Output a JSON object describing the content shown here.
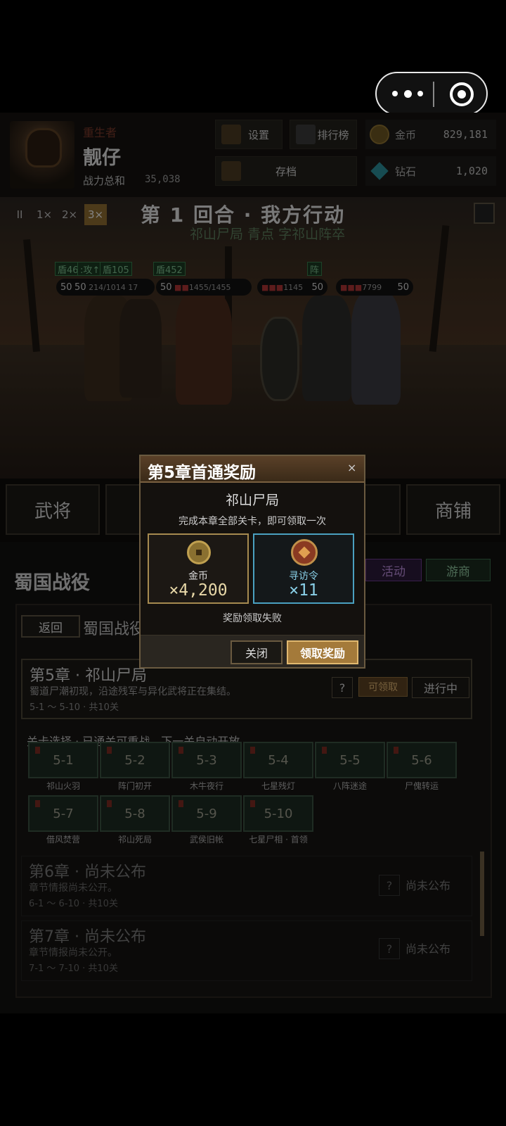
{
  "capsule": {
    "more_icon": "more-dots-icon",
    "close_icon": "target-circle-icon"
  },
  "header": {
    "role_label": "重生者",
    "player_name": "靓仔",
    "power_label": "战力总和",
    "power_value": "35,038",
    "settings_label": "设置",
    "ranking_label": "排行榜",
    "save_label": "存档",
    "gold_label": "金币",
    "gold_value": "829,181",
    "diamond_label": "钻石",
    "diamond_value": "1,020"
  },
  "battle": {
    "speed_controls": [
      "II",
      "1×",
      "2×",
      "3×"
    ],
    "round_text": "第 1 回合  ·  我方行动",
    "subtitle": "祁山尸局 青点 字祁山阵卒",
    "tags": [
      "盾46",
      ":攻↑",
      "盾105",
      "盾452",
      "阵"
    ],
    "levels": [
      "50",
      "50",
      "50",
      "50",
      "50"
    ],
    "hp_texts": [
      "214/1014",
      "17",
      "1455/1455",
      "1145",
      "7799"
    ]
  },
  "nav": {
    "generals": "武将",
    "shop": "商铺"
  },
  "campaign": {
    "title": "蜀国战役",
    "activity_label": "活动",
    "merchant_label": "游商",
    "back_label": "返回",
    "panel_title": "蜀国战役",
    "chapter5": {
      "title": "第5章  ·  祁山尸局",
      "desc": "蜀道尸潮初现，沿途残军与异化武将正在集结。",
      "meta": "5-1 ～ 5-10   ·   共10关",
      "help": "?",
      "claimable": "可领取",
      "status": "进行中"
    },
    "level_header": "关卡选择  ·  已通关可重战，下一关自动开放",
    "levels": [
      {
        "code": "5-1",
        "name": "祁山火羽"
      },
      {
        "code": "5-2",
        "name": "阵门初开"
      },
      {
        "code": "5-3",
        "name": "木牛夜行"
      },
      {
        "code": "5-4",
        "name": "七星残灯"
      },
      {
        "code": "5-5",
        "name": "八阵迷途"
      },
      {
        "code": "5-6",
        "name": "尸傀转运"
      },
      {
        "code": "5-7",
        "name": "借风焚营"
      },
      {
        "code": "5-8",
        "name": "祁山死局"
      },
      {
        "code": "5-9",
        "name": "武侯旧帐"
      },
      {
        "code": "5-10",
        "name": "七星尸相 · 首领"
      }
    ],
    "chapter6": {
      "title": "第6章  ·  尚未公布",
      "desc": "章节情报尚未公开。",
      "meta": "6-1 ～ 6-10   ·   共10关",
      "help": "?",
      "status": "尚未公布"
    },
    "chapter7": {
      "title": "第7章  ·  尚未公布",
      "desc": "章节情报尚未公开。",
      "meta": "7-1 ～ 7-10   ·   共10关",
      "help": "?",
      "status": "尚未公布"
    }
  },
  "modal": {
    "title": "第5章首通奖励",
    "close_glyph": "×",
    "subtitle": "祁山尸局",
    "desc": "完成本章全部关卡，即可领取一次",
    "reward1": {
      "label": "金币",
      "value": "×4,200",
      "icon": "gold-coin-icon"
    },
    "reward2": {
      "label": "寻访令",
      "value": "×11",
      "icon": "seek-token-icon"
    },
    "fail_text": "奖励领取失败",
    "close_label": "关闭",
    "claim_label": "领取奖励"
  },
  "colors": {
    "gold": "#a68a50",
    "cyan": "#4aa0c0",
    "claim": "#a47a3a"
  }
}
